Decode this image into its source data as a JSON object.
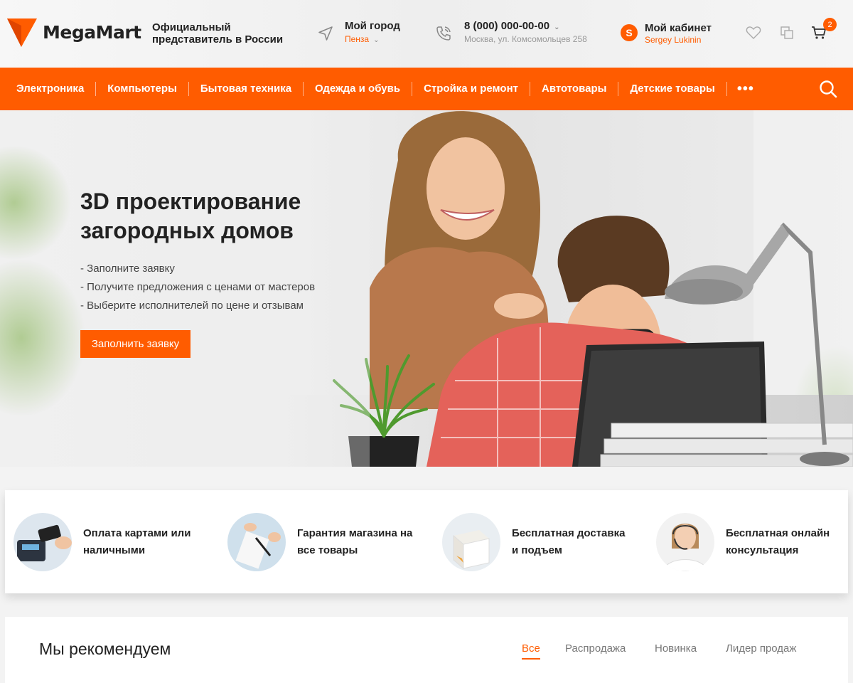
{
  "header": {
    "logo_text": "MegaMart",
    "tagline": "Официальный представитель в России",
    "city_title": "Мой город",
    "city_name": "Пенза",
    "phone_number": "8 (000) 000-00-00",
    "phone_address": "Москва, ул. Комсомольцев 258",
    "account_initial": "S",
    "account_title": "Мой кабинет",
    "account_user": "Sergey Lukinin",
    "cart_count": "2",
    "icons": [
      "location-arrow-icon",
      "phone-icon",
      "heart-icon",
      "compare-icon",
      "cart-icon"
    ]
  },
  "nav": {
    "items": [
      {
        "label": "Электроника"
      },
      {
        "label": "Компьютеры"
      },
      {
        "label": "Бытовая техника"
      },
      {
        "label": "Одежда и обувь"
      },
      {
        "label": "Стройка и ремонт"
      },
      {
        "label": "Автотовары"
      },
      {
        "label": "Детские товары"
      }
    ],
    "more": "•••"
  },
  "hero": {
    "title": "3D проектирование загородных домов",
    "bullets": [
      "- Заполните заявку",
      "- Получите предложения с ценами от мастеров",
      "- Выберите исполнителей по цене и отзывам"
    ],
    "button_label": "Заполнить заявку"
  },
  "features": [
    {
      "text": "Оплата картами или наличными"
    },
    {
      "text": "Гарантия магазина на все товары"
    },
    {
      "text": "Бесплатная доставка и подъем"
    },
    {
      "text": "Бесплатная онлайн консультация"
    }
  ],
  "recommend": {
    "title": "Мы рекомендуем",
    "tabs": [
      "Все",
      "Распродажа",
      "Новинка",
      "Лидер продаж"
    ],
    "active_tab": "Все"
  },
  "colors": {
    "accent": "#ff5c00",
    "text": "#222222"
  }
}
